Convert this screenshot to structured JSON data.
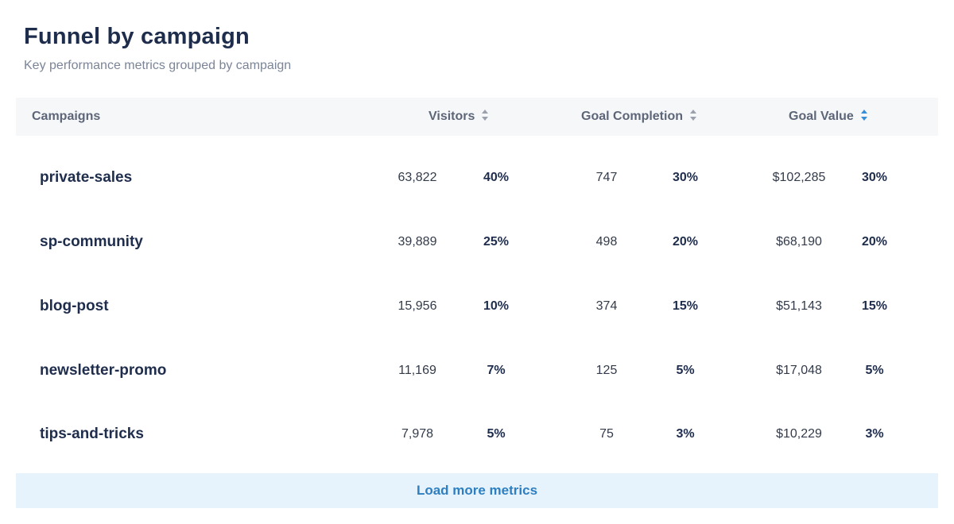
{
  "header": {
    "title": "Funnel by campaign",
    "subtitle": "Key performance metrics grouped by campaign"
  },
  "table": {
    "columns": {
      "campaigns": "Campaigns",
      "visitors": "Visitors",
      "goal_completion": "Goal Completion",
      "goal_value": "Goal Value"
    },
    "sort_icon_color": "#9aa1ad",
    "active_sort_icon_color": "#3a8ed6",
    "rows": [
      {
        "campaign": "private-sales",
        "visitors": "63,822",
        "visitors_pct": "40%",
        "goal_completion": "747",
        "goal_completion_pct": "30%",
        "goal_value": "$102,285",
        "goal_value_pct": "30%"
      },
      {
        "campaign": "sp-community",
        "visitors": "39,889",
        "visitors_pct": "25%",
        "goal_completion": "498",
        "goal_completion_pct": "20%",
        "goal_value": "$68,190",
        "goal_value_pct": "20%"
      },
      {
        "campaign": "blog-post",
        "visitors": "15,956",
        "visitors_pct": "10%",
        "goal_completion": "374",
        "goal_completion_pct": "15%",
        "goal_value": "$51,143",
        "goal_value_pct": "15%"
      },
      {
        "campaign": "newsletter-promo",
        "visitors": "11,169",
        "visitors_pct": "7%",
        "goal_completion": "125",
        "goal_completion_pct": "5%",
        "goal_value": "$17,048",
        "goal_value_pct": "5%"
      },
      {
        "campaign": "tips-and-tricks",
        "visitors": "7,978",
        "visitors_pct": "5%",
        "goal_completion": "75",
        "goal_completion_pct": "3%",
        "goal_value": "$10,229",
        "goal_value_pct": "3%"
      }
    ]
  },
  "footer": {
    "load_more_label": "Load more metrics"
  },
  "colors": {
    "accent": "#2d7fc1",
    "load_more_bg": "#e7f3fc",
    "header_bg": "#f6f7f9",
    "text_dark": "#1f2d4d"
  }
}
